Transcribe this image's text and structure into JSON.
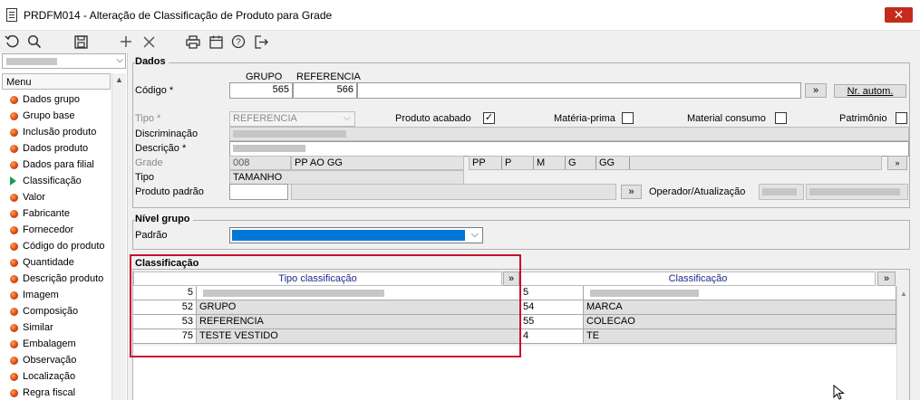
{
  "window": {
    "title": "PRDFM014 - Alteração de Classificação de Produto para Grade",
    "close_glyph": "✕"
  },
  "toolbar": {
    "refresh_icon": "↻",
    "search_icon": "⌕",
    "save_icon": "💾",
    "add_icon": "+",
    "cancel_icon": "✕",
    "print_icon": "🖶",
    "calendar_icon": "📅",
    "help_icon": "?",
    "exit_icon": "⇥"
  },
  "menu": {
    "header": "Menu",
    "items": [
      "Dados grupo",
      "Grupo base",
      "Inclusão produto",
      "Dados produto",
      "Dados para filial",
      "Classificação",
      "Valor",
      "Fabricante",
      "Fornecedor",
      "Código do produto",
      "Quantidade",
      "Descrição produto",
      "Imagem",
      "Composição",
      "Similar",
      "Embalagem",
      "Observação",
      "Localização",
      "Regra fiscal"
    ],
    "active_index": 5
  },
  "dados": {
    "title": "Dados",
    "codigo_label": "Código *",
    "grupo_header": "GRUPO",
    "referencia_header": "REFERENCIA",
    "grupo_value": "565",
    "referencia_value": "566",
    "arrow_btn": "»",
    "nr_autom_btn": "Nr. autom.",
    "tipo_label": "Tipo *",
    "tipo_value": "REFERENCIA",
    "produto_acabado_label": "Produto acabado",
    "produto_acabado_check": "✓",
    "materia_prima_label": "Matéria-prima",
    "material_consumo_label": "Material consumo",
    "patrimonio_label": "Patrimônio",
    "discriminacao_label": "Discriminação",
    "descricao_label": "Descrição *",
    "grade_label": "Grade",
    "grade_code": "008",
    "grade_desc": "PP AO GG",
    "sizes": [
      "PP",
      "P",
      "M",
      "G",
      "GG"
    ],
    "tipo2_label": "Tipo",
    "tipo2_value": "TAMANHO",
    "produto_padrao_label": "Produto padrão",
    "operador_label": "Operador/Atualização"
  },
  "nivel_grupo": {
    "title": "Nível grupo",
    "padrao_label": "Padrão"
  },
  "classificacao": {
    "title": "Classificação",
    "col_tipo": "Tipo classificação",
    "col_class": "Classificação",
    "expand_btn": "»",
    "rows": [
      {
        "tipo_code": "5",
        "tipo_desc": "",
        "class_code": "5",
        "class_desc": ""
      },
      {
        "tipo_code": "52",
        "tipo_desc": "GRUPO",
        "class_code": "54",
        "class_desc": "MARCA"
      },
      {
        "tipo_code": "53",
        "tipo_desc": "REFERENCIA",
        "class_code": "55",
        "class_desc": "COLECAO"
      },
      {
        "tipo_code": "75",
        "tipo_desc": "TESTE VESTIDO",
        "class_code": "4",
        "class_desc": "TE"
      }
    ]
  },
  "colors": {
    "selection_blue": "#0078d7",
    "highlight_red": "#c8102e",
    "close_red": "#c42b1c"
  }
}
